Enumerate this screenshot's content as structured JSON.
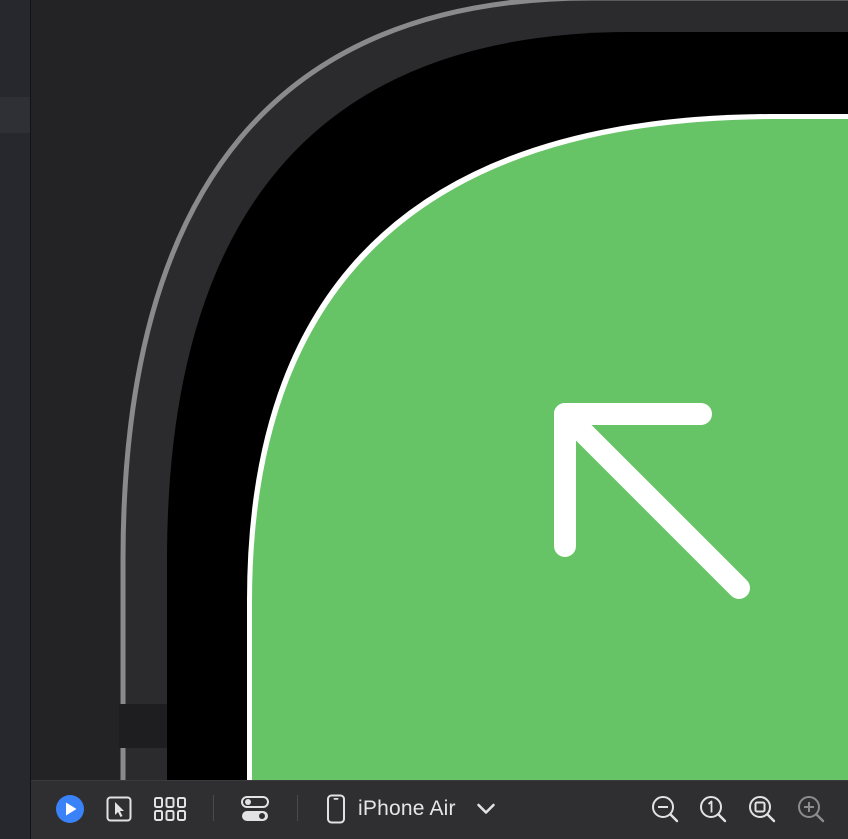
{
  "toolbar": {
    "device_name": "iPhone Air",
    "icons": {
      "live_preview": "play-circle-icon",
      "selectable": "cursor-select-icon",
      "variants": "grid-variants-icon",
      "settings": "toggle-settings-icon",
      "device": "iphone-icon",
      "device_menu": "chevron-down-icon",
      "zoom_out": "zoom-out-icon",
      "zoom_actual": "zoom-actual-size-icon",
      "zoom_fit": "zoom-to-fit-icon",
      "zoom_in": "zoom-in-icon"
    }
  },
  "colors": {
    "accent": "#3a82f7",
    "preview_background": "#66c466",
    "arrow": "#ffffff"
  },
  "canvas": {
    "preview_icon": "arrow-up-left-icon"
  }
}
